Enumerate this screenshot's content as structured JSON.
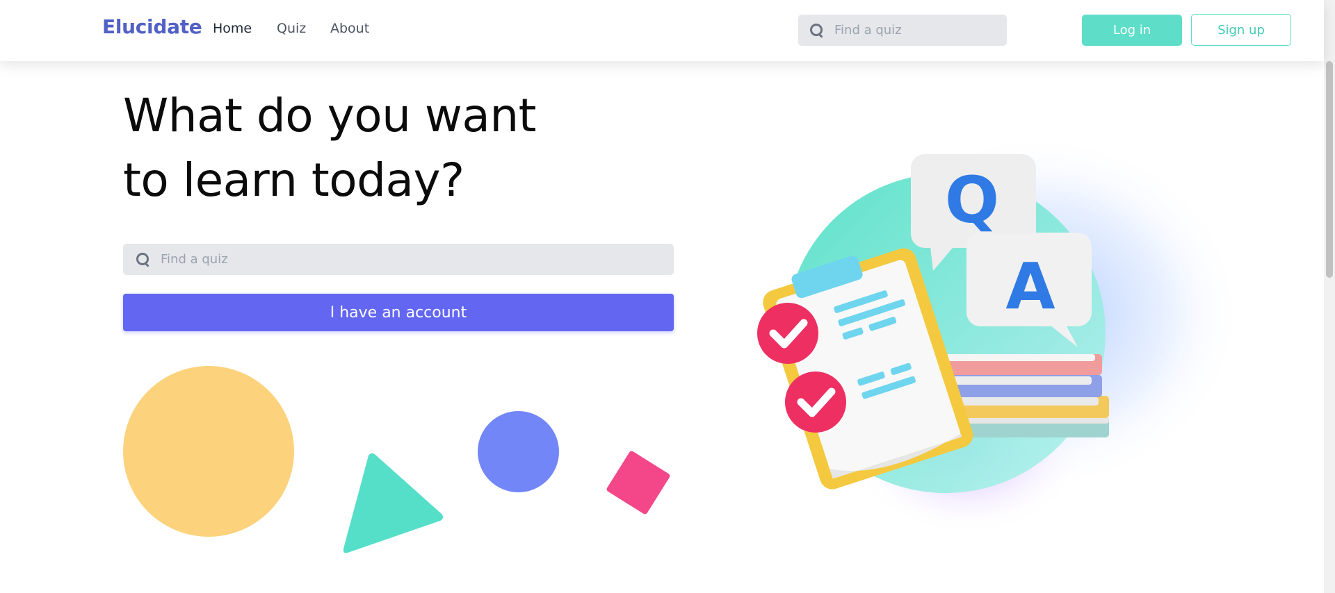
{
  "nav": {
    "logo": "Elucidate",
    "links": [
      {
        "label": "Home",
        "active": true
      },
      {
        "label": "Quiz",
        "active": false
      },
      {
        "label": "About",
        "active": false
      }
    ],
    "search_placeholder": "Find a quiz",
    "login_label": "Log in",
    "signup_label": "Sign up"
  },
  "hero": {
    "headline_line1": "What do you want",
    "headline_line2": "to learn today?",
    "search_placeholder": "Find a quiz",
    "account_button": "I have an account"
  },
  "illustration": {
    "bubble_q": "Q",
    "bubble_a": "A"
  },
  "colors": {
    "brand": "#5161c4",
    "accent_teal": "#5eddc8",
    "primary_button": "#6366f1",
    "yellow": "#fcd37c",
    "blue": "#7286f8",
    "pink": "#f3478a",
    "teal": "#55dfc9"
  },
  "icons": [
    "search-icon",
    "check-icon"
  ]
}
